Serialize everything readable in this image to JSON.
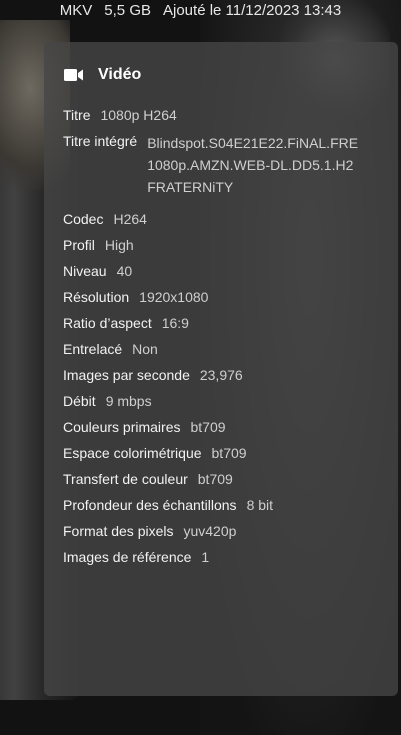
{
  "top_meta": {
    "container": "MKV",
    "size": "5,5 GB",
    "added": "Ajouté le 11/12/2023 13:43"
  },
  "panel": {
    "icon": "video-camera-icon",
    "title": "Vidéo",
    "rows": [
      {
        "label": "Titre",
        "value": "1080p H264"
      },
      {
        "label": "Titre intégré",
        "value_lines": [
          "Blindspot.S04E21E22.FiNAL.FRE",
          "1080p.AMZN.WEB-DL.DD5.1.H2",
          "FRATERNiTY"
        ]
      },
      {
        "label": "Codec",
        "value": "H264"
      },
      {
        "label": "Profil",
        "value": "High"
      },
      {
        "label": "Niveau",
        "value": "40"
      },
      {
        "label": "Résolution",
        "value": "1920x1080"
      },
      {
        "label": "Ratio d’aspect",
        "value": "16:9"
      },
      {
        "label": "Entrelacé",
        "value": "Non"
      },
      {
        "label": "Images par seconde",
        "value": "23,976"
      },
      {
        "label": "Débit",
        "value": "9 mbps"
      },
      {
        "label": "Couleurs primaires",
        "value": "bt709"
      },
      {
        "label": "Espace colorimétrique",
        "value": "bt709"
      },
      {
        "label": "Transfert de couleur",
        "value": "bt709"
      },
      {
        "label": "Profondeur des échantillons",
        "value": "8 bit"
      },
      {
        "label": "Format des pixels",
        "value": "yuv420p"
      },
      {
        "label": "Images de référence",
        "value": "1"
      }
    ]
  }
}
